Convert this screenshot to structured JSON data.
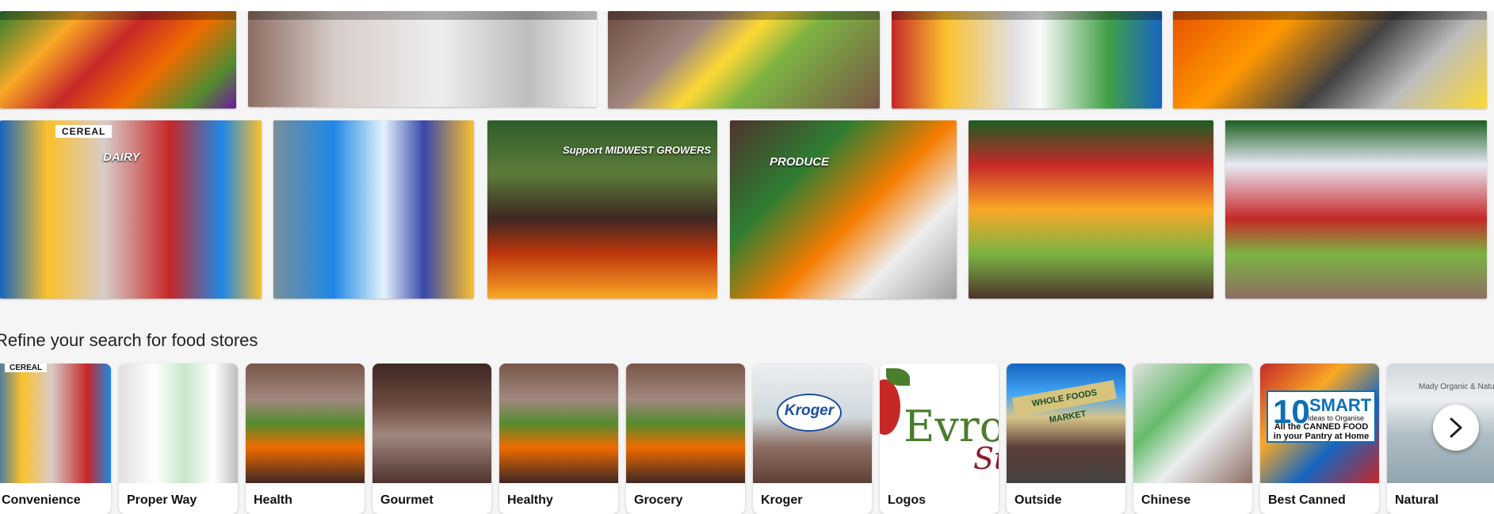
{
  "images": {
    "row1": [
      {
        "desc": "fruit-stand",
        "bg": "linear-gradient(135deg,#2e7d32 0%,#f9a825 25%,#c62828 45%,#ef6c00 65%,#558b2f 85%,#6a1b9a 100%)"
      },
      {
        "desc": "deli-case",
        "bg": "linear-gradient(90deg,#8d6e63 0%,#d7ccc8 25%,#eeeeee 55%,#bdbdbd 80%,#f5f5f5 100%)"
      },
      {
        "desc": "produce-display",
        "bg": "linear-gradient(135deg,#6d4c41 0%,#a1887f 30%,#fdd835 45%,#7cb342 60%,#795548 100%)"
      },
      {
        "desc": "store-aisle",
        "bg": "linear-gradient(90deg,#c62828 0%,#fbc02d 20%,#e0e0e0 45%,#fafafa 55%,#43a047 80%,#1565c0 100%)"
      },
      {
        "desc": "oranges-bins",
        "bg": "linear-gradient(135deg,#e65100 0%,#ff9800 30%,#424242 55%,#bdbdbd 75%,#fdd835 100%)"
      }
    ],
    "row2": [
      {
        "desc": "cereal-aisle",
        "tag": "CEREAL",
        "sign": "DAIRY",
        "bg": "linear-gradient(90deg,#1565c0 0%,#fbc02d 18%,#d7ccc8 40%,#c62828 65%,#1e88e5 85%,#fbc02d 100%)"
      },
      {
        "desc": "shopper-aisle",
        "bg": "linear-gradient(90deg,#78909c 0%,#1e88e5 30%,#e3f2fd 55%,#3949ab 75%,#fbc02d 100%)"
      },
      {
        "desc": "produce-section",
        "sign": "Support MIDWEST GROWERS",
        "bg": "linear-gradient(180deg,#2e5d2a 0%,#5d7b3a 30%,#3e2723 55%,#bf360c 75%,#f9a825 100%)"
      },
      {
        "desc": "produce-entrance",
        "sign": "PRODUCE",
        "bg": "linear-gradient(135deg,#4e342e 0%,#2e7d32 30%,#f57c00 55%,#eeeeee 75%,#9e9e9e 100%)"
      },
      {
        "desc": "produce-shelves",
        "bg": "linear-gradient(180deg,#1b5e20 0%,#c62828 25%,#f9a825 50%,#7cb342 75%,#4e342e 100%)"
      },
      {
        "desc": "apple-display",
        "bg": "linear-gradient(180deg,#1b5e20 0%,#e8eaf6 25%,#c62828 55%,#7cb342 75%,#8d6e63 100%)"
      }
    ]
  },
  "refine": {
    "heading": "Refine your search for food stores",
    "cards": [
      {
        "label": "Convenience",
        "tag": "CEREAL",
        "bg": "linear-gradient(90deg,#1565c0 0%,#fbc02d 25%,#d7ccc8 50%,#c62828 80%,#1e88e5 100%)"
      },
      {
        "label": "Proper Way",
        "bg": "linear-gradient(90deg,#e0e0e0 0%,#ffffff 30%,#c8e6c9 55%,#ffffff 80%,#bdbdbd 100%)"
      },
      {
        "label": "Health",
        "bg": "linear-gradient(180deg,#795548 0%,#a1887f 30%,#558b2f 50%,#ef6c00 70%,#3e2723 100%)"
      },
      {
        "label": "Gourmet",
        "bg": "linear-gradient(180deg,#3e2723 0%,#6d4c41 35%,#a1887f 60%,#4e342e 100%)"
      },
      {
        "label": "Healthy",
        "bg": "linear-gradient(180deg,#795548 0%,#a1887f 30%,#558b2f 50%,#ef6c00 70%,#3e2723 100%)"
      },
      {
        "label": "Grocery",
        "bg": "linear-gradient(180deg,#795548 0%,#a1887f 30%,#558b2f 50%,#ef6c00 70%,#3e2723 100%)"
      },
      {
        "label": "Kroger",
        "logo": "Kroger",
        "bg": "linear-gradient(180deg,#eceff1 0%,#cfd8dc 45%,#8d6e63 70%,#5d4037 100%)"
      },
      {
        "label": "Logos",
        "logo": "Evro",
        "logo2": "St",
        "bg": "linear-gradient(180deg,#ffffff 0%,#ffffff 100%)"
      },
      {
        "label": "Outside",
        "sign": "WHOLE FOODS MARKET",
        "bg": "linear-gradient(180deg,#1565c0 0%,#42a5f5 25%,#d7c48a 45%,#5d4037 70%,#424242 100%)"
      },
      {
        "label": "Chinese",
        "bg": "linear-gradient(135deg,#e0e0e0 0%,#66bb6a 35%,#eceff1 60%,#8d6e63 100%)"
      },
      {
        "label": "Best Canned",
        "canned": {
          "num": "10",
          "big": "SMART",
          "sub": "Ideas to Organise",
          "line": "All the CANNED FOOD in your Pantry at Home"
        },
        "bg": "linear-gradient(135deg,#c62828 0%,#f9a825 35%,#1565c0 65%,#c62828 100%)"
      },
      {
        "label": "Natural",
        "sign": "Mady Organic & Natu",
        "bg": "linear-gradient(180deg,#cfd8dc 0%,#eceff1 30%,#b0bec5 60%,#90a4ae 100%)"
      }
    ]
  },
  "next_button": {
    "icon": "chevron-right-icon"
  }
}
